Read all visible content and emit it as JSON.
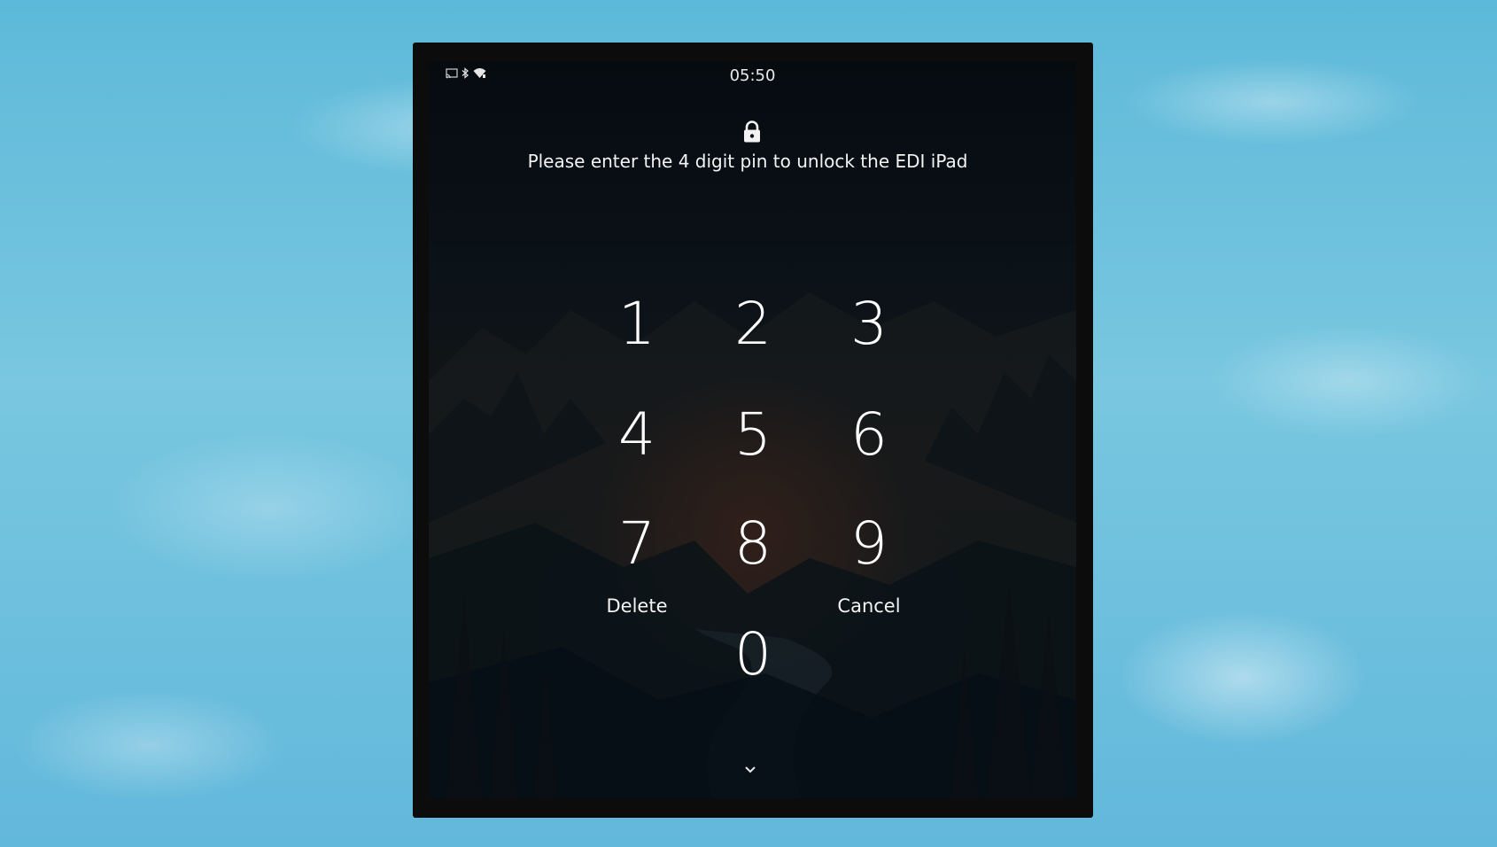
{
  "status_bar": {
    "time": "05:50",
    "icons": [
      "cast-icon",
      "bluetooth-icon",
      "wifi-icon"
    ]
  },
  "lock_screen": {
    "icon": "lock-icon",
    "prompt": "Please enter the 4 digit pin to unlock the EDI iPad",
    "keypad": {
      "k1": "1",
      "k2": "2",
      "k3": "3",
      "k4": "4",
      "k5": "5",
      "k6": "6",
      "k7": "7",
      "k8": "8",
      "k9": "9",
      "k0": "0"
    },
    "delete_label": "Delete",
    "cancel_label": "Cancel",
    "expand_icon": "chevron-down-icon"
  },
  "colors": {
    "background": "#6cc1df",
    "frame": "#0c0c0c",
    "text": "#ffffff"
  }
}
